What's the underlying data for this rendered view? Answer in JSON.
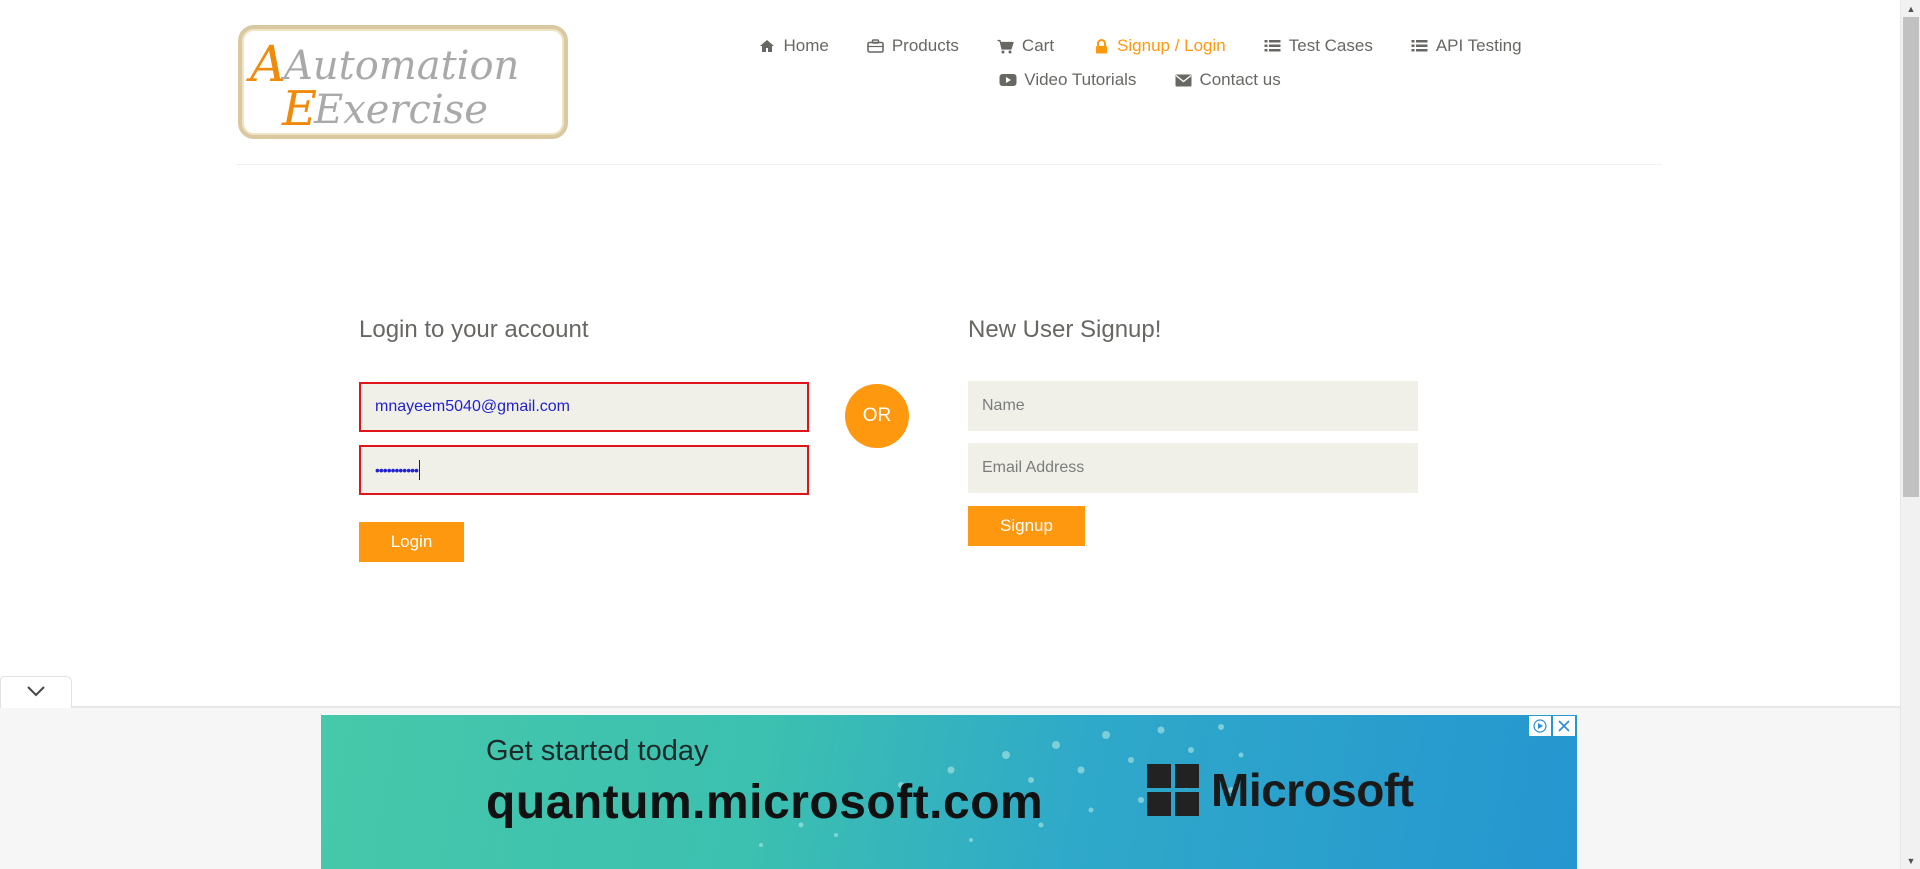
{
  "logo": {
    "line1": "Automation",
    "line2": "Exercise"
  },
  "nav": {
    "row1": [
      {
        "label": "Home",
        "icon": "home-icon"
      },
      {
        "label": "Products",
        "icon": "briefcase-icon"
      },
      {
        "label": "Cart",
        "icon": "cart-icon"
      },
      {
        "label": "Signup / Login",
        "icon": "lock-icon",
        "active": true
      },
      {
        "label": "Test Cases",
        "icon": "list-icon"
      },
      {
        "label": "API Testing",
        "icon": "list-icon"
      }
    ],
    "row2": [
      {
        "label": "Video Tutorials",
        "icon": "youtube-play-icon"
      },
      {
        "label": "Contact us",
        "icon": "envelope-icon"
      }
    ]
  },
  "login": {
    "title": "Login to your account",
    "email_value": "mnayeem5040@gmail.com",
    "password_value": "•••••••••••",
    "button_label": "Login"
  },
  "divider": {
    "or_label": "OR"
  },
  "signup": {
    "title": "New User Signup!",
    "name_placeholder": "Name",
    "email_placeholder": "Email Address",
    "button_label": "Signup"
  },
  "ad": {
    "line1": "Get started today",
    "line2": "quantum.microsoft.com",
    "brand": "Microsoft"
  },
  "colors": {
    "accent": "#fe980f",
    "text": "#696763",
    "error_border": "#e0141b",
    "field_bg": "#f0f0e9"
  }
}
